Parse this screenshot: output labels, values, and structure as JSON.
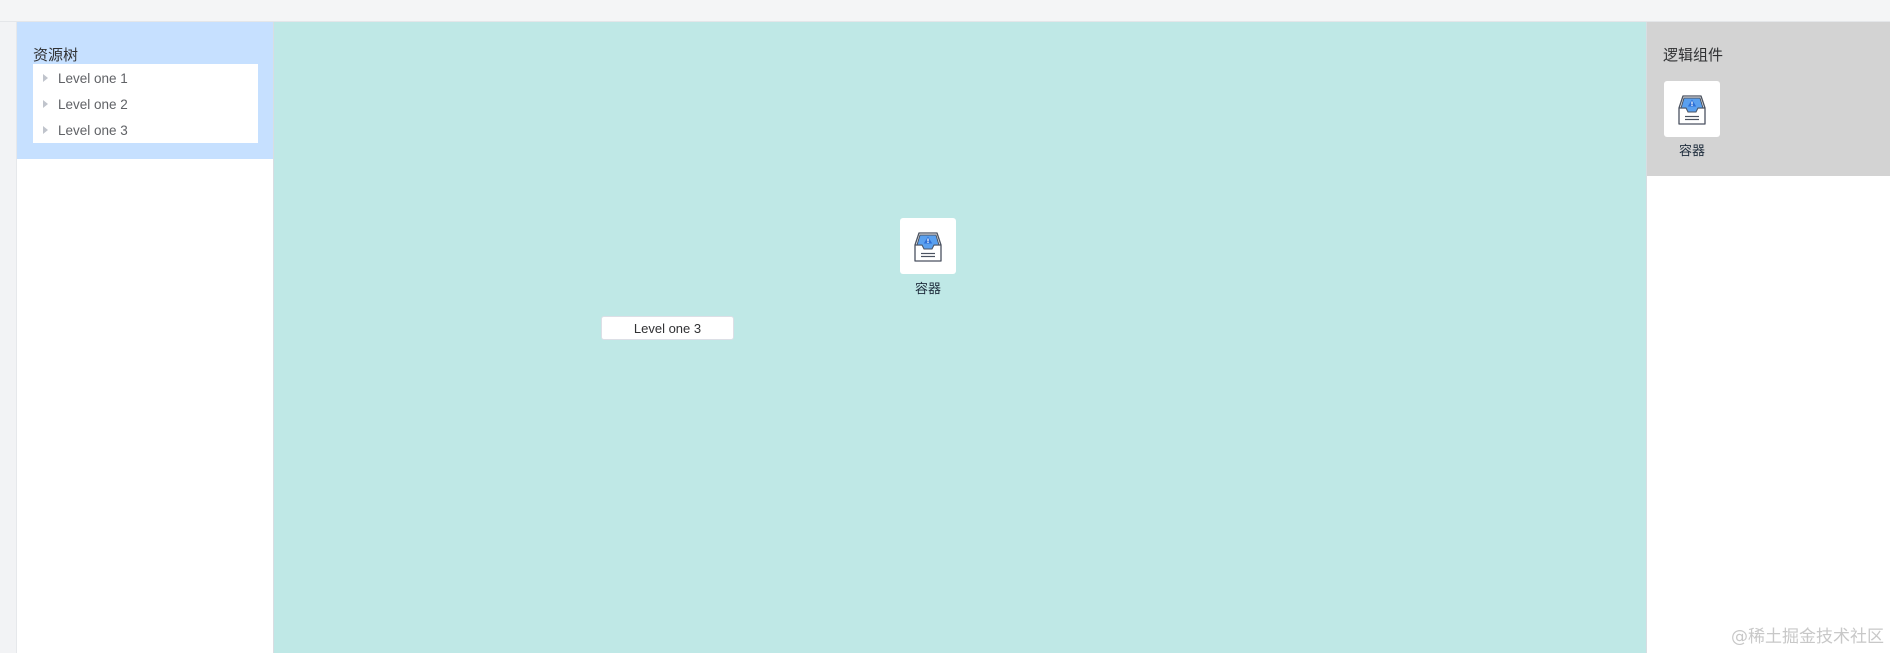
{
  "left_panel": {
    "title": "资源树",
    "tree_items": [
      {
        "label": "Level one 1"
      },
      {
        "label": "Level one 2"
      },
      {
        "label": "Level one 3"
      }
    ]
  },
  "canvas": {
    "container_node": {
      "label": "容器",
      "icon": "container-inbox-icon"
    },
    "dropped_item": {
      "label": "Level one 3"
    }
  },
  "right_panel": {
    "title": "逻辑组件",
    "components": [
      {
        "label": "容器",
        "icon": "container-inbox-icon"
      }
    ]
  },
  "watermark": "@稀土掘金技术社区",
  "colors": {
    "left_header_bg": "#c6e0ff",
    "canvas_bg": "#bfe8e6",
    "right_header_bg": "#d3d3d3",
    "icon_accent": "#5aa0ef"
  }
}
